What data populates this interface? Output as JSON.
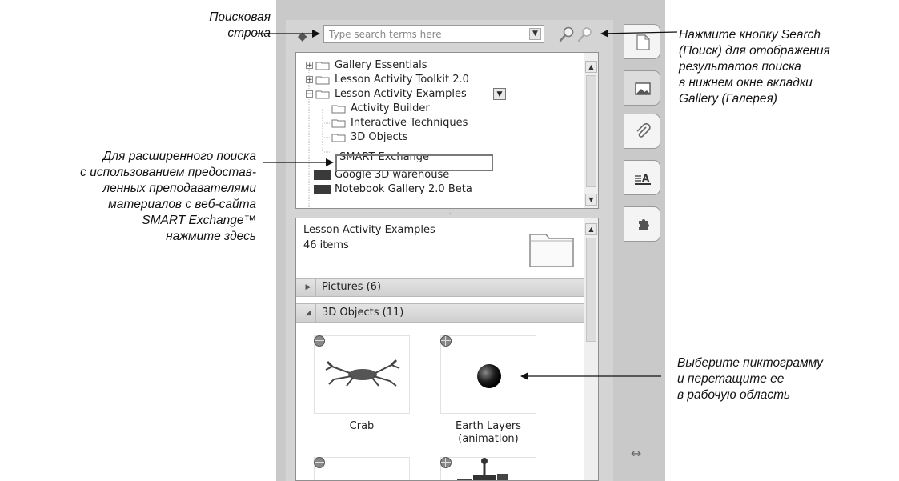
{
  "annotations": {
    "search_bar": "Поисковая\nстрока",
    "search_button": "Нажмите кнопку Search\n(Поиск) для отображения\nрезультатов поиска\nв нижнем окне вкладки\nGallery (Галерея)",
    "smart_exchange": "Для расширенного поиска\nс использованием предостав-\nленных преподавателями\nматериалов с веб-сайта\nSMART Exchange™\nнажмите здесь",
    "drag_item": "Выберите пиктограмму\nи перетащите ее\nв рабочую область"
  },
  "search": {
    "placeholder": "Type search terms here",
    "back_icon": "back-arrow-icon",
    "search_icon": "magnifier-icon",
    "advanced_icon": "advanced-search-icon"
  },
  "tree": {
    "items": [
      {
        "label": "Gallery Essentials",
        "icon": "folder-icon",
        "expander": "+"
      },
      {
        "label": "Lesson Activity Toolkit 2.0",
        "icon": "folder-icon",
        "expander": "+"
      },
      {
        "label": "Lesson Activity Examples",
        "icon": "folder-icon",
        "expander": "−",
        "selected": true
      },
      {
        "label": "Activity Builder",
        "icon": "folder-icon"
      },
      {
        "label": "Interactive Techniques",
        "icon": "folder-icon"
      },
      {
        "label": "3D Objects",
        "icon": "folder-icon"
      },
      {
        "label": "SMART Exchange",
        "icon": "smart-exchange-icon",
        "highlighted": true
      },
      {
        "label": "Google 3D warehouse",
        "icon": "smart-logo-icon"
      },
      {
        "label": "Notebook Gallery 2.0 Beta",
        "icon": "smart-logo-icon"
      }
    ]
  },
  "content": {
    "title": "Lesson Activity Examples",
    "count": "46 items",
    "sections": [
      {
        "label": "Pictures (6)",
        "expanded": false
      },
      {
        "label": "3D Objects (11)",
        "expanded": true
      }
    ],
    "items": [
      {
        "caption": "Crab",
        "icon": "crab-3d-icon"
      },
      {
        "caption": "Earth Layers\n(animation)",
        "icon": "sphere-3d-icon"
      }
    ]
  },
  "tabs": [
    {
      "name": "page-sorter-tab",
      "icon": "page-icon"
    },
    {
      "name": "gallery-tab",
      "icon": "gallery-picture-icon",
      "active": true
    },
    {
      "name": "attachments-tab",
      "icon": "paperclip-icon"
    },
    {
      "name": "properties-tab",
      "icon": "properties-icon"
    },
    {
      "name": "addons-tab",
      "icon": "puzzle-icon"
    }
  ],
  "resize_icon": "resize-arrows-icon"
}
